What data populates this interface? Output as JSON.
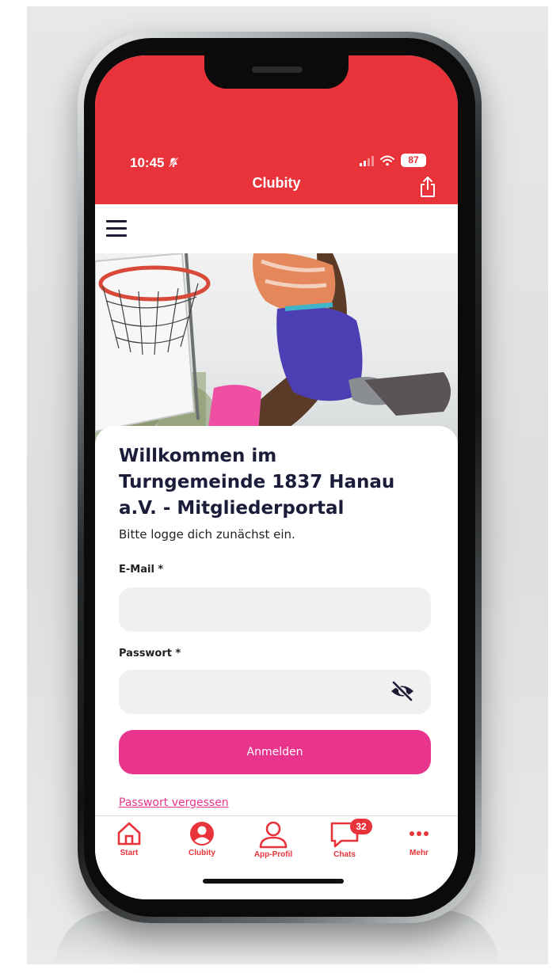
{
  "status": {
    "time": "10:45",
    "battery": "87"
  },
  "header": {
    "title": "Clubity"
  },
  "login": {
    "welcome_line1": "Willkommen im",
    "welcome_line2": "Turngemeinde 1837 Hanau",
    "welcome_line3": "a.V. - Mitgliederportal",
    "subtitle": "Bitte logge dich zunächst ein.",
    "email_label": "E-Mail *",
    "email_value": "",
    "password_label": "Passwort *",
    "password_value": "",
    "submit_label": "Anmelden",
    "forgot_label": "Passwort vergessen"
  },
  "tabbar": {
    "items": [
      {
        "label": "Start",
        "icon": "home-icon"
      },
      {
        "label": "Clubity",
        "icon": "user-circle-icon"
      },
      {
        "label": "App-Profil",
        "icon": "user-outline-icon"
      },
      {
        "label": "Chats",
        "icon": "chat-icon",
        "badge": "32"
      },
      {
        "label": "Mehr",
        "icon": "more-dots-icon"
      }
    ]
  },
  "colors": {
    "header_red": "#e8333a",
    "accent_pink": "#e8348c",
    "title_navy": "#1b1b3a"
  }
}
